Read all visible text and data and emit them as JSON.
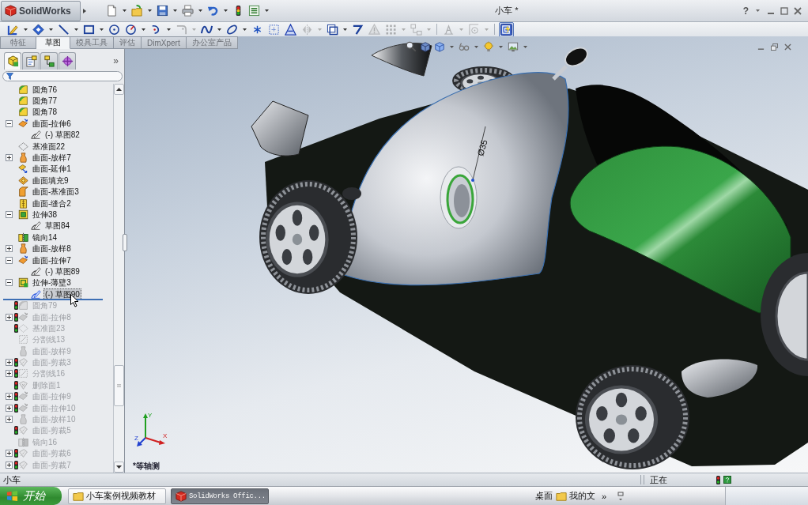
{
  "title_bar": {
    "logo": "SolidWorks",
    "title": "小车 *",
    "help": "?",
    "quick_access": [
      {
        "kind": "new",
        "dropdown": true
      },
      {
        "kind": "open",
        "dropdown": true
      },
      {
        "kind": "save",
        "dropdown": true
      },
      {
        "kind": "print",
        "dropdown": true
      },
      {
        "kind": "undo",
        "dropdown": true
      },
      {
        "kind": "rebuild",
        "dropdown": false
      },
      {
        "kind": "options",
        "dropdown": true
      }
    ]
  },
  "command_toolbar": [
    {
      "kind": "sketch",
      "dropdown": true,
      "disabled": false,
      "on": false
    },
    {
      "kind": "smart_dimension",
      "dropdown": true,
      "disabled": false,
      "on": false
    },
    {
      "kind": "line",
      "dropdown": true,
      "disabled": false,
      "on": false
    },
    {
      "kind": "rectangle",
      "dropdown": true,
      "disabled": false,
      "on": false
    },
    {
      "kind": "circle",
      "dropdown": false,
      "disabled": false,
      "on": false
    },
    {
      "kind": "perimeter_circle",
      "dropdown": true,
      "disabled": false,
      "on": false
    },
    {
      "kind": "arc",
      "dropdown": true,
      "disabled": false,
      "on": false
    },
    {
      "kind": "sketch_fillet",
      "dropdown": true,
      "disabled": true,
      "on": false
    },
    {
      "kind": "spline",
      "dropdown": true,
      "disabled": false,
      "on": false
    },
    {
      "kind": "ellipse",
      "dropdown": true,
      "disabled": false,
      "on": false
    },
    {
      "kind": "point",
      "dropdown": false,
      "disabled": false,
      "on": false
    },
    {
      "kind": "construction",
      "dropdown": false,
      "disabled": false,
      "on": false
    },
    {
      "kind": "text",
      "dropdown": false,
      "disabled": false,
      "on": false
    },
    {
      "kind": "mirror",
      "dropdown": true,
      "disabled": true,
      "on": false
    },
    {
      "kind": "offset",
      "dropdown": true,
      "disabled": false,
      "on": false
    },
    {
      "kind": "trim",
      "dropdown": false,
      "disabled": false,
      "on": false
    },
    {
      "kind": "relations",
      "dropdown": false,
      "disabled": true,
      "on": false
    },
    {
      "kind": "pattern",
      "dropdown": true,
      "disabled": true,
      "on": false
    },
    {
      "kind": "move",
      "dropdown": true,
      "disabled": true,
      "on": false
    },
    {
      "kind": "separator"
    },
    {
      "kind": "repair",
      "dropdown": true,
      "disabled": true,
      "on": false
    },
    {
      "kind": "plane",
      "dropdown": true,
      "disabled": true,
      "on": false
    },
    {
      "kind": "separator"
    },
    {
      "kind": "instant3d",
      "dropdown": false,
      "disabled": false,
      "on": true
    }
  ],
  "tabs": [
    {
      "label": "特征",
      "selected": false
    },
    {
      "label": "草图",
      "selected": true
    },
    {
      "label": "模具工具",
      "selected": false
    },
    {
      "label": "评估",
      "selected": false
    },
    {
      "label": "DimXpert",
      "selected": false
    },
    {
      "label": "办公室产品",
      "selected": false
    }
  ],
  "feature_tree": {
    "panel_tabs": [
      {
        "kind": "feature_manager",
        "selected": true
      },
      {
        "kind": "property_manager",
        "selected": false
      },
      {
        "kind": "configuration_manager",
        "selected": false
      },
      {
        "kind": "dimxpert",
        "selected": false
      }
    ],
    "more": "»",
    "items": [
      {
        "label": "圆角76",
        "kind": "fillet",
        "selected": false,
        "rolled_back": false,
        "status_light": false
      },
      {
        "label": "圆角77",
        "kind": "fillet",
        "selected": false,
        "rolled_back": false,
        "status_light": false
      },
      {
        "label": "圆角78",
        "kind": "fillet",
        "selected": false,
        "rolled_back": false,
        "status_light": false
      },
      {
        "label": "曲面-拉伸6",
        "kind": "surface_extrude",
        "expanded": true,
        "selected": false,
        "rolled_back": false,
        "status_light": false,
        "children": [
          {
            "label": "(-) 草图82",
            "kind": "sketch",
            "selected": false,
            "rolled_back": false,
            "status_light": false
          }
        ]
      },
      {
        "label": "基准面22",
        "kind": "plane",
        "selected": false,
        "rolled_back": false,
        "status_light": false
      },
      {
        "label": "曲面-放样7",
        "kind": "loft",
        "expanded": false,
        "selected": false,
        "rolled_back": false,
        "status_light": false
      },
      {
        "label": "曲面-延伸1",
        "kind": "surface_extend",
        "selected": false,
        "rolled_back": false,
        "status_light": false
      },
      {
        "label": "曲面填充9",
        "kind": "fill",
        "selected": false,
        "rolled_back": false,
        "status_light": false
      },
      {
        "label": "曲面-基准面3",
        "kind": "planar_surface",
        "selected": false,
        "rolled_back": false,
        "status_light": false
      },
      {
        "label": "曲面-缝合2",
        "kind": "knit",
        "selected": false,
        "rolled_back": false,
        "status_light": false
      },
      {
        "label": "拉伸38",
        "kind": "extrude",
        "expanded": true,
        "selected": false,
        "rolled_back": false,
        "status_light": false,
        "children": [
          {
            "label": "草图84",
            "kind": "sketch",
            "selected": false,
            "rolled_back": false,
            "status_light": false
          }
        ]
      },
      {
        "label": "镜向14",
        "kind": "mirror",
        "selected": false,
        "rolled_back": false,
        "status_light": false
      },
      {
        "label": "曲面-放样8",
        "kind": "loft",
        "expanded": false,
        "selected": false,
        "rolled_back": false,
        "status_light": false
      },
      {
        "label": "曲面-拉伸7",
        "kind": "surface_extrude",
        "expanded": true,
        "selected": false,
        "rolled_back": false,
        "status_light": false,
        "children": [
          {
            "label": "(-) 草图89",
            "kind": "sketch",
            "selected": false,
            "rolled_back": false,
            "status_light": false
          }
        ]
      },
      {
        "label": "拉伸-薄壁3",
        "kind": "thin_extrude",
        "expanded": true,
        "selected": false,
        "rolled_back": false,
        "status_light": false,
        "children": [
          {
            "label": "(-) 草图90",
            "kind": "sketch",
            "selected": true,
            "rolled_back": false,
            "status_light": false
          }
        ]
      },
      {
        "kind": "rollback_bar"
      },
      {
        "label": "圆角79",
        "kind": "fillet",
        "selected": false,
        "rolled_back": true,
        "status_light": true
      },
      {
        "label": "曲面-拉伸8",
        "kind": "surface_extrude",
        "expanded": false,
        "selected": false,
        "rolled_back": true,
        "status_light": true
      },
      {
        "label": "基准面23",
        "kind": "plane",
        "selected": false,
        "rolled_back": true,
        "status_light": true
      },
      {
        "label": "分割线13",
        "kind": "split_line",
        "selected": false,
        "rolled_back": true,
        "status_light": false
      },
      {
        "label": "曲面-放样9",
        "kind": "loft",
        "selected": false,
        "rolled_back": true,
        "status_light": false
      },
      {
        "label": "曲面-剪裁3",
        "kind": "trim",
        "expanded": false,
        "selected": false,
        "rolled_back": true,
        "status_light": true
      },
      {
        "label": "分割线16",
        "kind": "split_line",
        "expanded": false,
        "selected": false,
        "rolled_back": true,
        "status_light": true
      },
      {
        "label": "删除面1",
        "kind": "delete_face",
        "selected": false,
        "rolled_back": true,
        "status_light": true
      },
      {
        "label": "曲面-拉伸9",
        "kind": "surface_extrude",
        "expanded": false,
        "selected": false,
        "rolled_back": true,
        "status_light": true
      },
      {
        "label": "曲面-拉伸10",
        "kind": "surface_extrude",
        "expanded": false,
        "selected": false,
        "rolled_back": true,
        "status_light": true
      },
      {
        "label": "曲面-放样10",
        "kind": "loft",
        "expanded": false,
        "selected": false,
        "rolled_back": true,
        "status_light": false
      },
      {
        "label": "曲面-剪裁5",
        "kind": "trim",
        "selected": false,
        "rolled_back": true,
        "status_light": true
      },
      {
        "label": "镜向16",
        "kind": "mirror",
        "selected": false,
        "rolled_back": true,
        "status_light": false
      },
      {
        "label": "曲面-剪裁6",
        "kind": "trim",
        "expanded": false,
        "selected": false,
        "rolled_back": true,
        "status_light": true
      },
      {
        "label": "曲面-剪裁7",
        "kind": "trim",
        "expanded": false,
        "selected": false,
        "rolled_back": true,
        "status_light": true
      }
    ]
  },
  "viewport": {
    "heads_up_tools": [
      {
        "kind": "zoom_to_fit",
        "dropdown": false
      },
      {
        "kind": "section_view",
        "dropdown": false
      },
      {
        "kind": "view_orientation",
        "dropdown": true
      },
      {
        "kind": "hide_show",
        "dropdown": true
      },
      {
        "kind": "appearance",
        "dropdown": true
      },
      {
        "kind": "scene",
        "dropdown": true
      }
    ],
    "dimension": "Ø35",
    "triad": {
      "x": "X",
      "y": "Y",
      "z": "Z"
    },
    "view_label": "*等轴测"
  },
  "status_bar": {
    "document": "小车",
    "message": "正在"
  },
  "taskbar": {
    "start": "开始",
    "tasks": [
      {
        "kind": "folder",
        "label": "小车案例视频教材",
        "selected": false
      },
      {
        "kind": "solidworks",
        "label": "SolidWorks Offic...",
        "selected": true
      }
    ],
    "quick_launch": [
      {
        "kind": "text",
        "label": "桌面"
      },
      {
        "kind": "folder",
        "label": "我的文"
      }
    ],
    "more": "»"
  }
}
